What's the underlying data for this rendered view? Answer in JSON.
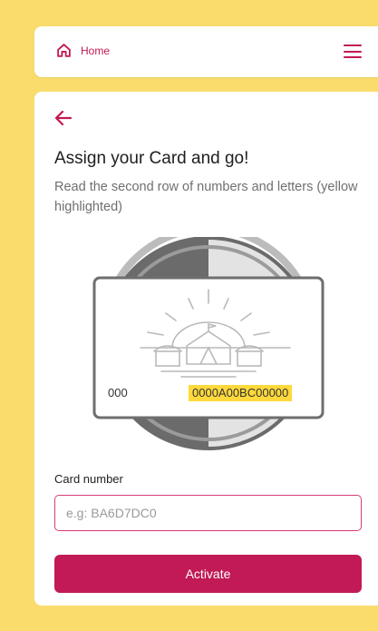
{
  "nav": {
    "home_label": "Home",
    "home_icon": "home-icon",
    "menu_icon": "hamburger-menu-icon"
  },
  "colors": {
    "accent": "#C21A56",
    "background": "#F9DC6C",
    "highlight": "#FFD93B"
  },
  "page": {
    "back_icon": "arrow-left-icon",
    "title": "Assign your Card and go!",
    "subtitle": "Read the second row of numbers and letters (yellow highlighted)"
  },
  "card_illustration": {
    "code_first_row": "000",
    "code_second_row": "0000A00BC00000"
  },
  "form": {
    "card_number_label": "Card number",
    "card_number_value": "",
    "card_number_placeholder": "e.g: BA6D7DC0",
    "activate_label": "Activate"
  }
}
